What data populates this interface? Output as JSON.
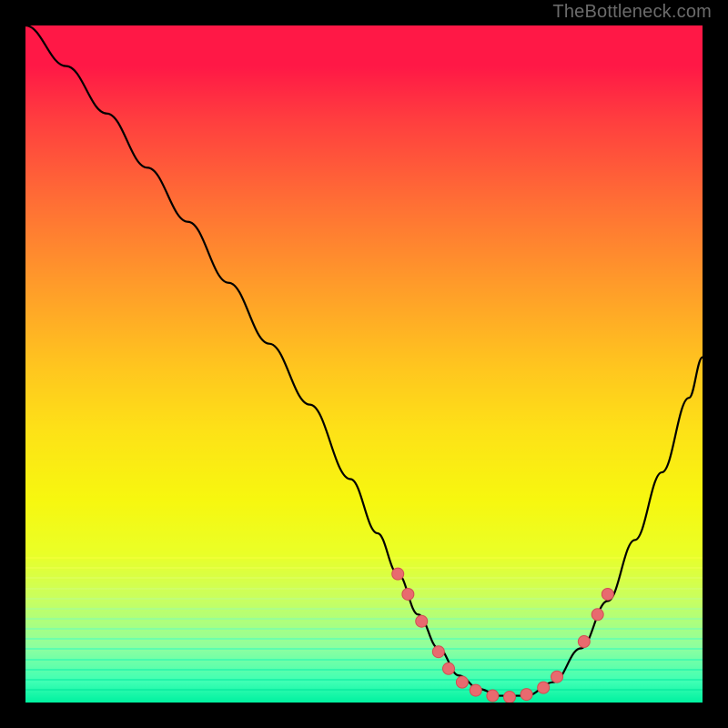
{
  "watermark": "TheBottleneck.com",
  "colors": {
    "dot_fill": "#e86a6f",
    "dot_stroke": "#d24d51",
    "curve": "#000000",
    "frame": "#000000"
  },
  "chart_data": {
    "type": "line",
    "title": "",
    "xlabel": "",
    "ylabel": "",
    "xlim": [
      0,
      100
    ],
    "ylim": [
      0,
      100
    ],
    "grid": false,
    "series": [
      {
        "name": "bottleneck-curve",
        "x": [
          0,
          6,
          12,
          18,
          24,
          30,
          36,
          42,
          48,
          52,
          55,
          58,
          61,
          64,
          67,
          70,
          74,
          78,
          82,
          86,
          90,
          94,
          98,
          100
        ],
        "y": [
          100,
          94,
          87,
          79,
          71,
          62,
          53,
          44,
          33,
          25,
          19,
          13,
          8,
          4,
          2,
          1,
          1,
          3,
          8,
          15,
          24,
          34,
          45,
          51
        ]
      }
    ],
    "markers": [
      {
        "x": 55,
        "y": 19
      },
      {
        "x": 56.5,
        "y": 16
      },
      {
        "x": 58.5,
        "y": 12
      },
      {
        "x": 61,
        "y": 7.5
      },
      {
        "x": 62.5,
        "y": 5
      },
      {
        "x": 64.5,
        "y": 3
      },
      {
        "x": 66.5,
        "y": 1.8
      },
      {
        "x": 69,
        "y": 1
      },
      {
        "x": 71.5,
        "y": 0.8
      },
      {
        "x": 74,
        "y": 1.2
      },
      {
        "x": 76.5,
        "y": 2.2
      },
      {
        "x": 78.5,
        "y": 3.8
      },
      {
        "x": 82.5,
        "y": 9
      },
      {
        "x": 84.5,
        "y": 13
      },
      {
        "x": 86,
        "y": 16
      }
    ],
    "horizontal_bands": [
      {
        "y": 21.5,
        "color": "#f7ff3a"
      },
      {
        "y": 20.0,
        "color": "#eeff4e"
      },
      {
        "y": 18.5,
        "color": "#e0ff63"
      },
      {
        "y": 17.0,
        "color": "#ceff78"
      },
      {
        "y": 15.5,
        "color": "#b8ff8c"
      },
      {
        "y": 14.0,
        "color": "#9fff9e"
      },
      {
        "y": 12.5,
        "color": "#84ffae"
      },
      {
        "y": 11.0,
        "color": "#69ffba"
      },
      {
        "y": 9.5,
        "color": "#4fffbe"
      },
      {
        "y": 8.0,
        "color": "#36fcbb"
      },
      {
        "y": 6.5,
        "color": "#22f7b4"
      },
      {
        "y": 5.0,
        "color": "#12f2ac"
      },
      {
        "y": 3.5,
        "color": "#07eda4"
      },
      {
        "y": 2.0,
        "color": "#00e79c"
      }
    ]
  }
}
